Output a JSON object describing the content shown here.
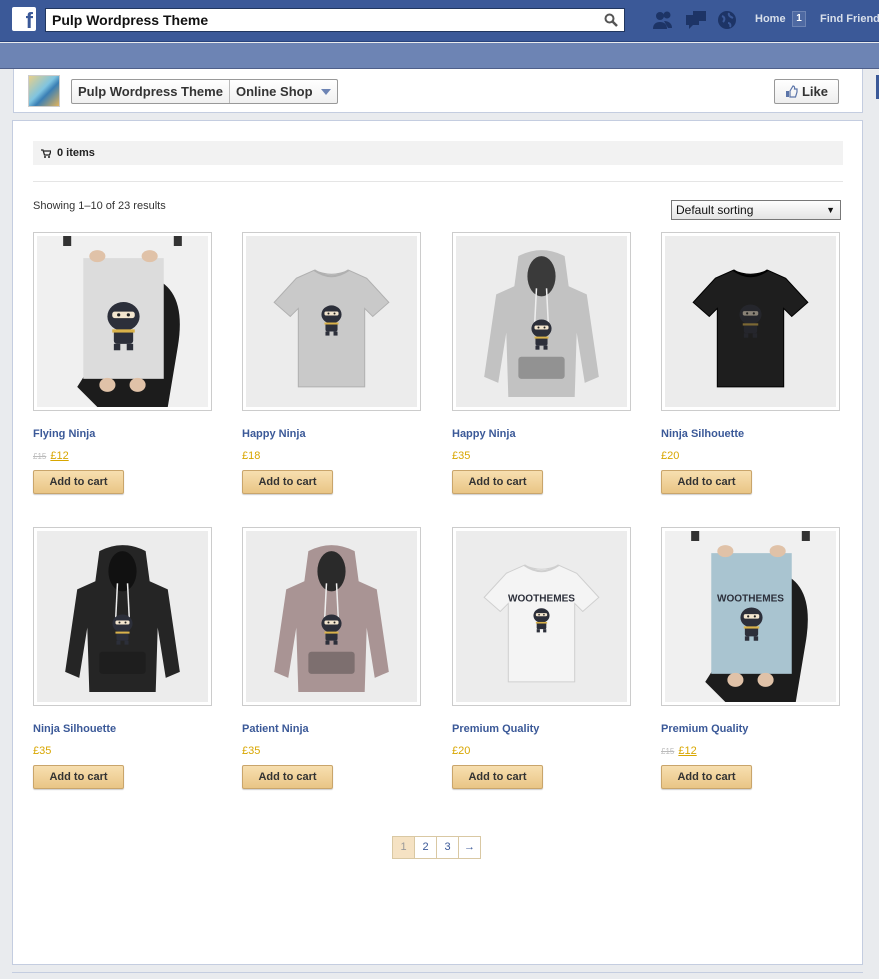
{
  "topbar": {
    "search_value": "Pulp Wordpress Theme",
    "nav_home": "Home",
    "nav_home_count": "1",
    "nav_find": "Find Friends"
  },
  "page_header": {
    "crumb_page": "Pulp Wordpress Theme",
    "crumb_tab": "Online Shop",
    "like_label": "Like"
  },
  "shop": {
    "cart_label": "0 items",
    "result_count": "Showing 1–10 of 23 results",
    "sort_selected": "Default sorting",
    "add_label": "Add to cart",
    "products": [
      {
        "title": "Flying Ninja",
        "old_price": "£15",
        "price": "£12",
        "kind": "poster-ninja"
      },
      {
        "title": "Happy Ninja",
        "old_price": "",
        "price": "£18",
        "kind": "tshirt-grey"
      },
      {
        "title": "Happy Ninja",
        "old_price": "",
        "price": "£35",
        "kind": "hoodie-grey"
      },
      {
        "title": "Ninja Silhouette",
        "old_price": "",
        "price": "£20",
        "kind": "tshirt-black"
      },
      {
        "title": "Ninja Silhouette",
        "old_price": "",
        "price": "£35",
        "kind": "hoodie-black"
      },
      {
        "title": "Patient Ninja",
        "old_price": "",
        "price": "£35",
        "kind": "hoodie-pink"
      },
      {
        "title": "Premium Quality",
        "old_price": "",
        "price": "£20",
        "kind": "tshirt-white"
      },
      {
        "title": "Premium Quality",
        "old_price": "£15",
        "price": "£12",
        "kind": "poster-blue"
      }
    ],
    "pagination": [
      "1",
      "2",
      "3",
      "→"
    ],
    "current_page": "1"
  },
  "colors": {
    "fb_blue": "#3b5998",
    "price": "#d8a600",
    "button": "#e9c585"
  }
}
